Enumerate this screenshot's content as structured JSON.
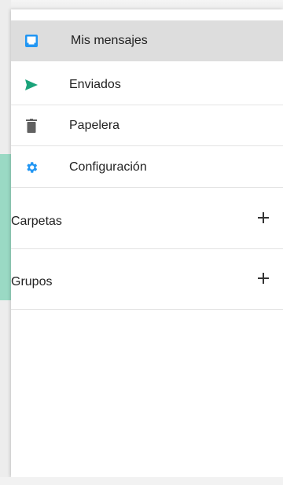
{
  "nav": {
    "items": [
      {
        "label": "Mis mensajes",
        "icon": "inbox-icon",
        "active": true
      },
      {
        "label": "Enviados",
        "icon": "send-icon"
      },
      {
        "label": "Papelera",
        "icon": "trash-icon"
      },
      {
        "label": "Configuración",
        "icon": "gear-icon"
      }
    ]
  },
  "sections": {
    "folders": {
      "label": "Carpetas",
      "action_icon": "plus-icon"
    },
    "groups": {
      "label": "Grupos",
      "action_icon": "plus-icon"
    }
  },
  "colors": {
    "accent_blue": "#2196f3",
    "accent_teal": "#1aa37a",
    "icon_gray": "#616161",
    "active_bg": "#dddddd"
  }
}
